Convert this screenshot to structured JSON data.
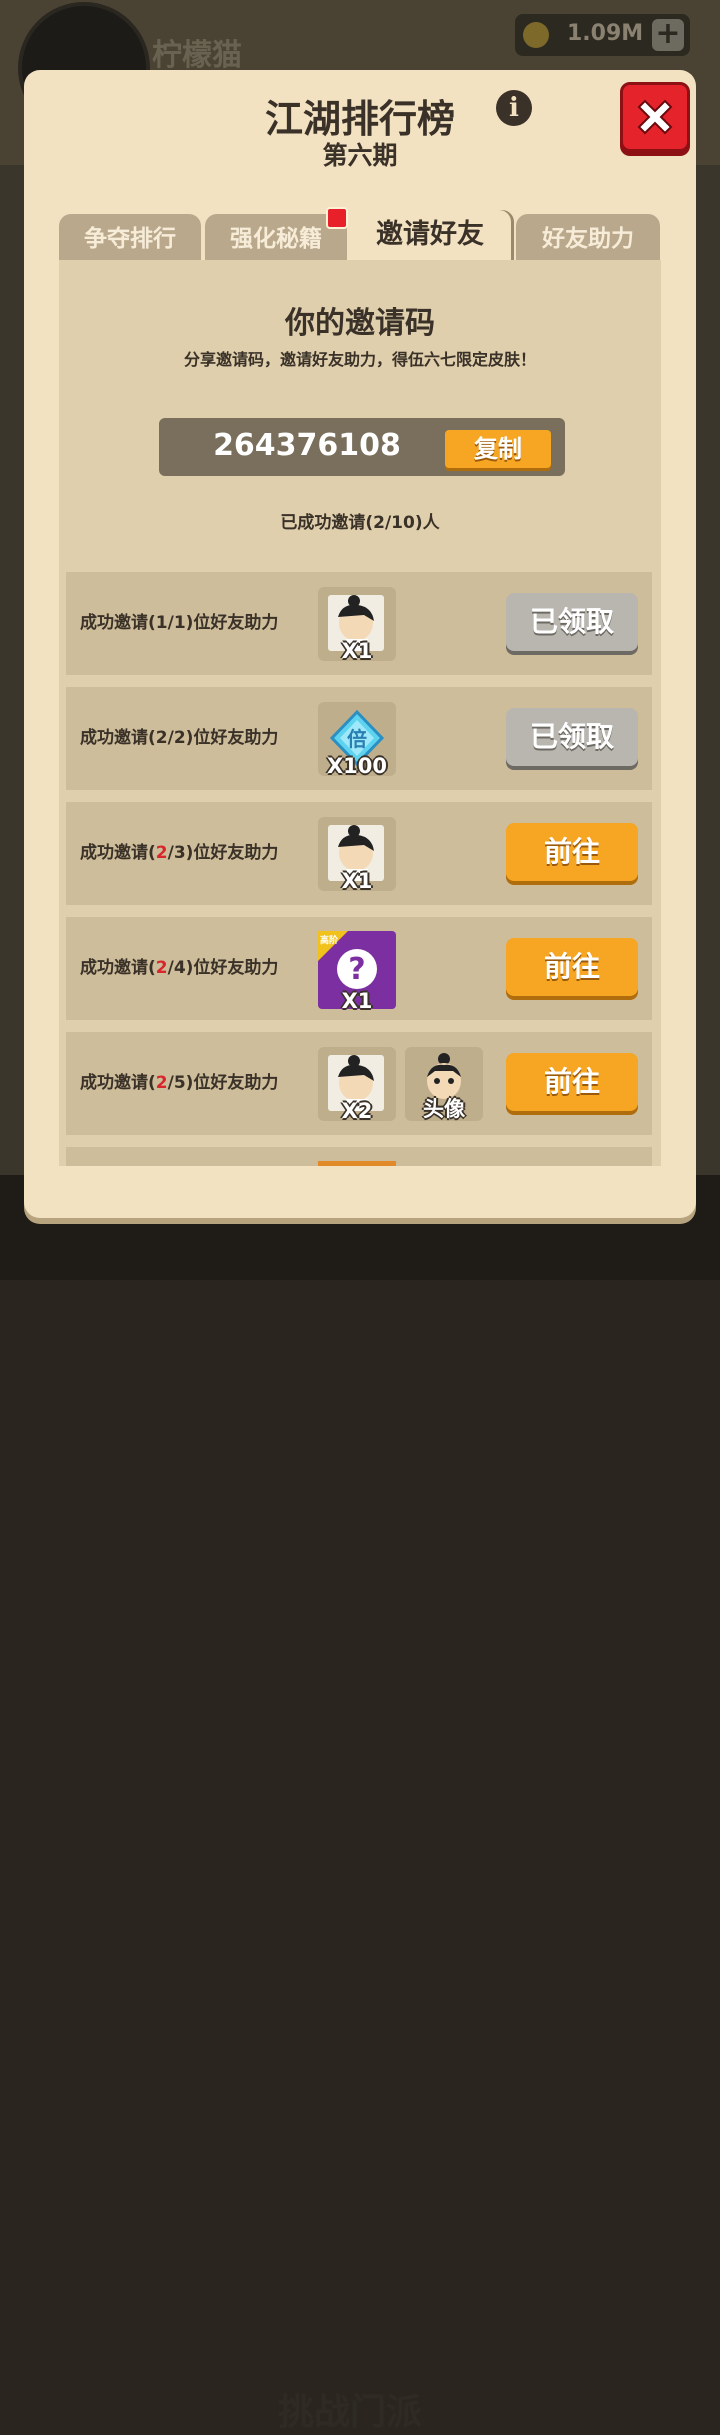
{
  "background": {
    "player_name": "柠檬猫",
    "currency_value": "1.09M",
    "bottom_label": "挑战门派"
  },
  "dialog": {
    "title": "江湖排行榜",
    "subtitle": "第六期",
    "info_icon": "i",
    "close_icon": "close-icon"
  },
  "tabs": [
    {
      "label": "争夺排行",
      "active": false
    },
    {
      "label": "强化秘籍",
      "active": false,
      "badge": true
    },
    {
      "label": "邀请好友",
      "active": true
    },
    {
      "label": "好友助力",
      "active": false
    }
  ],
  "invite": {
    "title": "你的邀请码",
    "description": "分享邀请码，邀请好友助力，得伍六七限定皮肤！",
    "code": "264376108",
    "copy_label": "复制",
    "invited_status": "已成功邀请(2/10)人"
  },
  "rows": [
    {
      "prefix": "成功邀请(",
      "current": "1",
      "current_highlight": false,
      "suffix": "/1)位好友助力",
      "rewards": [
        {
          "icon": "character-card-icon",
          "qty": "X1"
        }
      ],
      "button": "已领取",
      "button_state": "claimed"
    },
    {
      "prefix": "成功邀请(",
      "current": "2",
      "current_highlight": false,
      "suffix": "/2)位好友助力",
      "rewards": [
        {
          "icon": "multiplier-gem-icon",
          "qty": "X100",
          "glyph": "倍"
        }
      ],
      "button": "已领取",
      "button_state": "claimed"
    },
    {
      "prefix": "成功邀请(",
      "current": "2",
      "current_highlight": true,
      "suffix": "/3)位好友助力",
      "rewards": [
        {
          "icon": "character-card-icon",
          "qty": "X1"
        }
      ],
      "button": "前往",
      "button_state": "go"
    },
    {
      "prefix": "成功邀请(",
      "current": "2",
      "current_highlight": true,
      "suffix": "/4)位好友助力",
      "rewards": [
        {
          "icon": "mystery-box-icon",
          "qty": "X1",
          "tag": "高阶",
          "glyph": "?"
        }
      ],
      "button": "前往",
      "button_state": "go"
    },
    {
      "prefix": "成功邀请(",
      "current": "2",
      "current_highlight": true,
      "suffix": "/5)位好友助力",
      "rewards": [
        {
          "icon": "character-card-icon",
          "qty": "X2"
        },
        {
          "icon": "avatar-icon",
          "qty": "头像"
        }
      ],
      "button": "前往",
      "button_state": "go"
    }
  ],
  "colors": {
    "dialog_bg": "#f3e2c1",
    "panel_bg": "#dfcfac",
    "row_bg": "#cebd9a",
    "go_button": "#f6a623",
    "claimed_button": "#b9b6b0",
    "close_button": "#e4232a",
    "highlight_text": "#d8262d"
  }
}
